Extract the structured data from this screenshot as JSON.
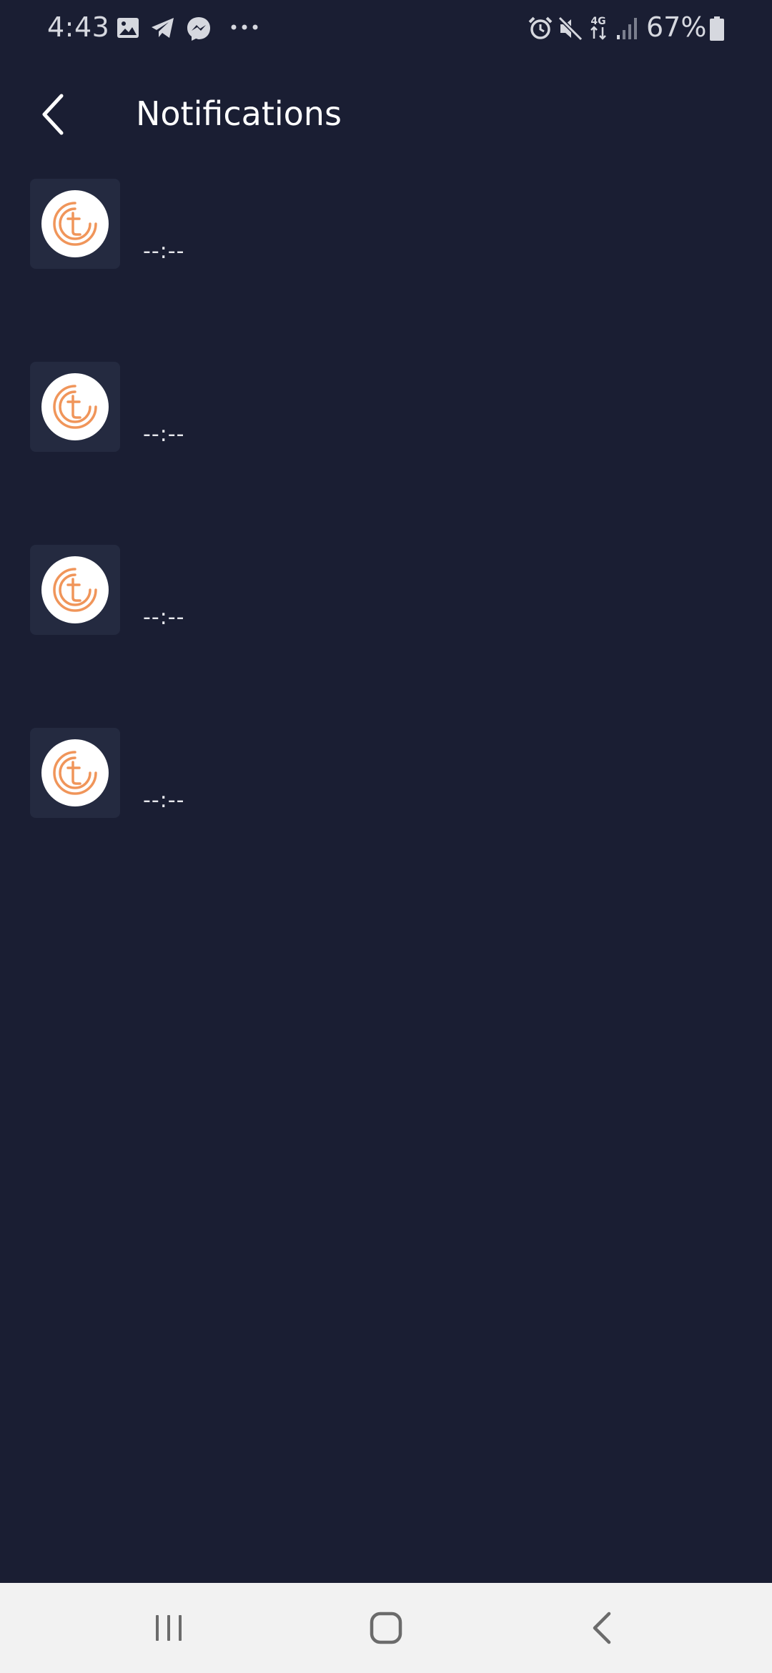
{
  "status_bar": {
    "time": "4:43",
    "left_icons": [
      "gallery-icon",
      "telegram-icon",
      "messenger-icon",
      "more-dots-icon"
    ],
    "right_icons": [
      "alarm-icon",
      "mute-icon",
      "4g-data-icon",
      "signal-icon",
      "battery-icon"
    ],
    "network": "4G",
    "battery": "67%"
  },
  "header": {
    "back_icon": "chevron-left-icon",
    "title": "Notifications"
  },
  "notifications": [
    {
      "icon": "app-logo-icon",
      "time": "--:--"
    },
    {
      "icon": "app-logo-icon",
      "time": "--:--"
    },
    {
      "icon": "app-logo-icon",
      "time": "--:--"
    },
    {
      "icon": "app-logo-icon",
      "time": "--:--"
    }
  ],
  "nav_bar": {
    "recents_icon": "recents-icon",
    "home_icon": "home-icon",
    "back_icon": "back-icon"
  },
  "colors": {
    "background": "#1a1e33",
    "avatar_tile": "#242a40",
    "logo_orange": "#f0955a",
    "nav_background": "#f2f2f2"
  }
}
